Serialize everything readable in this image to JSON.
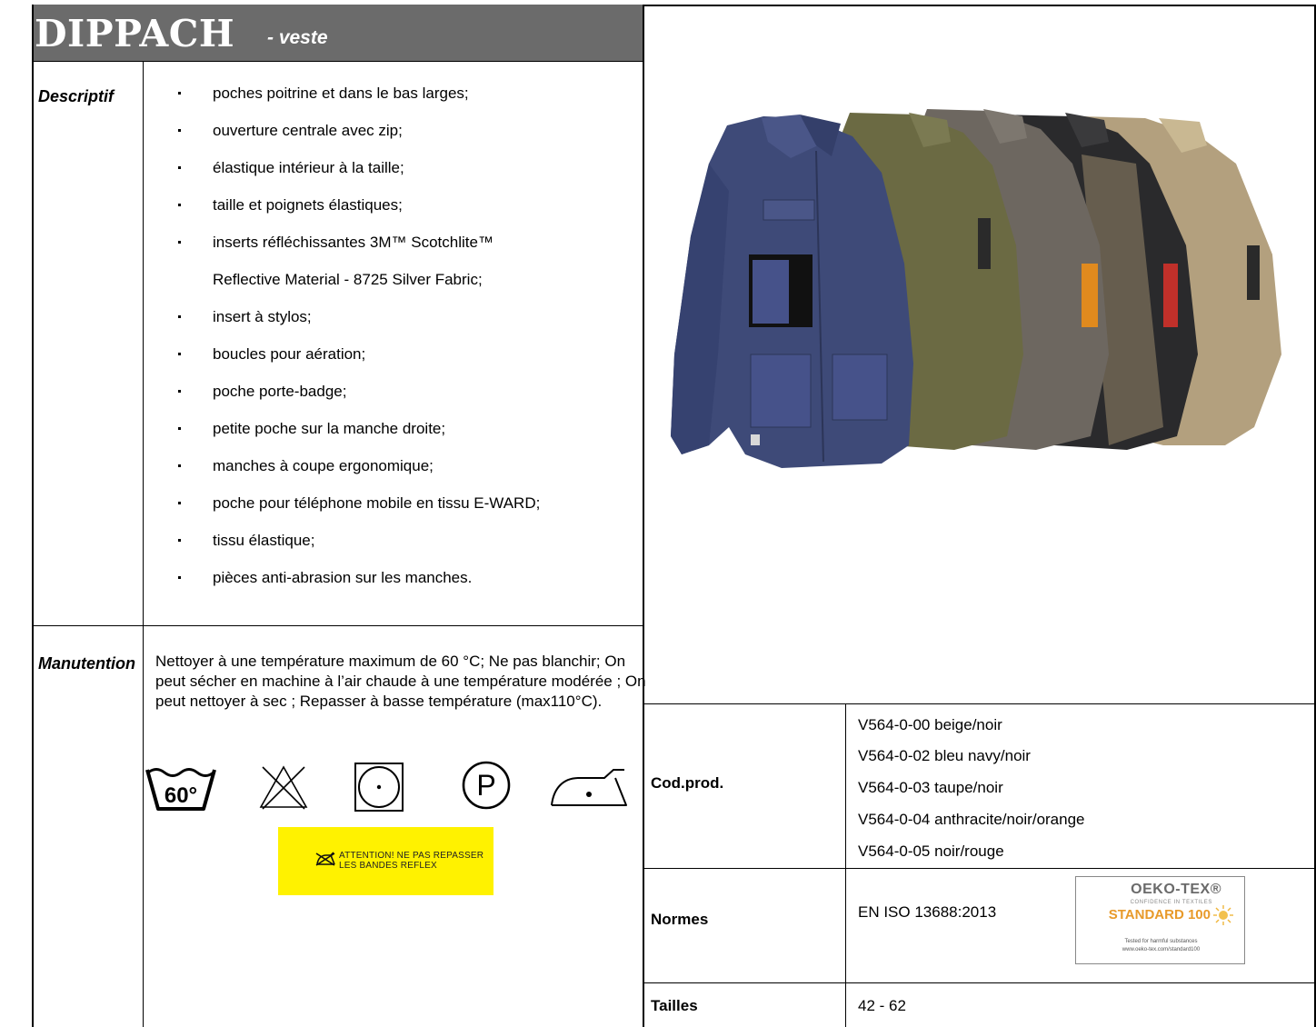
{
  "header": {
    "product_name": "DIPPACH",
    "product_type": "- veste"
  },
  "description": {
    "label": "Descriptif",
    "items": [
      "poches poitrine et dans le bas larges;",
      "ouverture centrale avec zip;",
      "élastique intérieur à la taille;",
      "taille et poignets élastiques;",
      "inserts réfléchissantes 3M™ Scotchlite™",
      "insert à stylos;",
      "boucles pour aération;",
      "poche porte-badge;",
      "petite poche sur la manche droite;",
      "manches à coupe ergonomique;",
      "poche pour téléphone mobile en tissu E-WARD;",
      "tissu élastique;",
      "pièces anti-abrasion sur les manches."
    ],
    "item_continuation": "Reflective Material - 8725 Silver Fabric;"
  },
  "care": {
    "label": "Manutention",
    "text": "Nettoyer à une température maximum de 60 °C; Ne pas blanchir; On peut sécher en machine à l’air chaude à une température  modérée ; On peut nettoyer à sec ; Repasser à basse température  (max110°C).",
    "wash_temp": "60°",
    "dryclean_letter": "P",
    "icons": [
      "wash-60-icon",
      "no-bleach-icon",
      "tumble-dry-icon",
      "dry-clean-p-icon",
      "iron-low-icon"
    ],
    "warning_label": {
      "line1": "ATTENTION! NE PAS REPASSER",
      "line2": "LES BANDES REFLEX",
      "background": "#fff200"
    }
  },
  "product_codes": {
    "label": "Cod.prod.",
    "items": [
      "V564-0-00 beige/noir",
      "V564-0-02 bleu navy/noir",
      "V564-0-03 taupe/noir",
      "V564-0-04 anthracite/noir/orange",
      "V564-0-05 noir/rouge"
    ]
  },
  "standards": {
    "label": "Normes",
    "value": "EN ISO 13688:2013",
    "badge": {
      "brand": "OEKO-TEX®",
      "tagline": "CONFIDENCE IN TEXTILES",
      "standard": "STANDARD 100",
      "note1": "Tested for harmful substances",
      "note2": "www.oeko-tex.com/standard100"
    }
  },
  "sizes": {
    "label": "Tailles",
    "value": "42 - 62"
  },
  "colors": {
    "header_bg": "#6b6b6b",
    "jackets": [
      "#3e4a78",
      "#6b6a43",
      "#6d6760",
      "#2a2a2c",
      "#b3a07e"
    ],
    "badge_orange": "#e08a1e",
    "warning_yellow": "#fff200"
  }
}
